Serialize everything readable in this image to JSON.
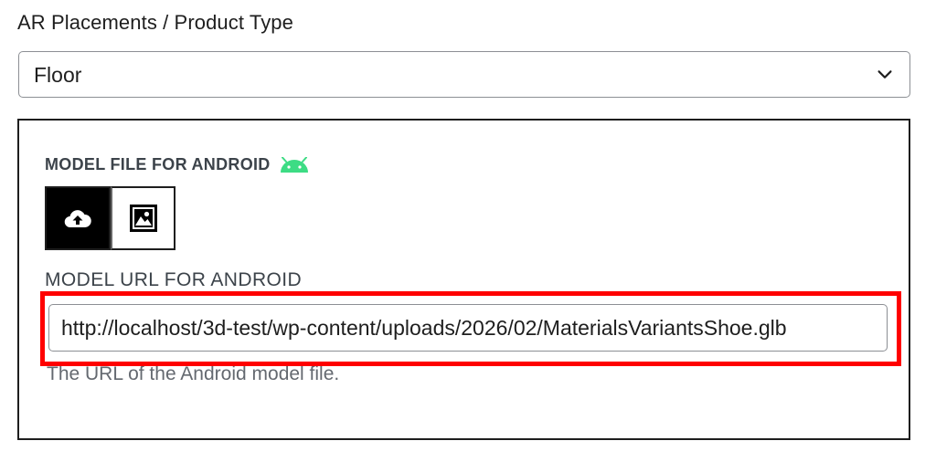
{
  "placement": {
    "label": "AR Placements / Product Type",
    "selected": "Floor"
  },
  "android": {
    "file_title": "MODEL FILE FOR ANDROID",
    "buttons": [
      {
        "name": "upload-button",
        "icon": "cloud-upload-icon"
      },
      {
        "name": "media-library-button",
        "icon": "image-icon"
      }
    ],
    "url_label": "Model URL for Android",
    "url_value": "http://localhost/3d-test/wp-content/uploads/2026/02/MaterialsVariantsShoe.glb",
    "help_text": "The URL of the Android model file."
  },
  "colors": {
    "android_green": "#3ddc84",
    "highlight": "#ff0000"
  }
}
